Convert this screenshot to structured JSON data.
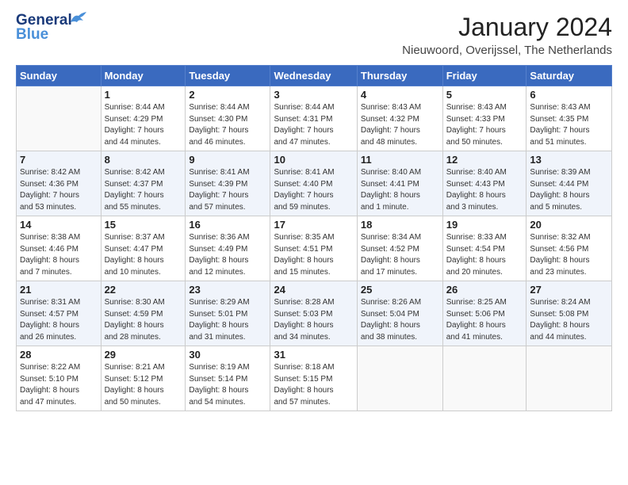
{
  "header": {
    "logo_line1": "General",
    "logo_line2": "Blue",
    "month": "January 2024",
    "location": "Nieuwoord, Overijssel, The Netherlands"
  },
  "weekdays": [
    "Sunday",
    "Monday",
    "Tuesday",
    "Wednesday",
    "Thursday",
    "Friday",
    "Saturday"
  ],
  "weeks": [
    [
      {
        "num": "",
        "info": ""
      },
      {
        "num": "1",
        "info": "Sunrise: 8:44 AM\nSunset: 4:29 PM\nDaylight: 7 hours\nand 44 minutes."
      },
      {
        "num": "2",
        "info": "Sunrise: 8:44 AM\nSunset: 4:30 PM\nDaylight: 7 hours\nand 46 minutes."
      },
      {
        "num": "3",
        "info": "Sunrise: 8:44 AM\nSunset: 4:31 PM\nDaylight: 7 hours\nand 47 minutes."
      },
      {
        "num": "4",
        "info": "Sunrise: 8:43 AM\nSunset: 4:32 PM\nDaylight: 7 hours\nand 48 minutes."
      },
      {
        "num": "5",
        "info": "Sunrise: 8:43 AM\nSunset: 4:33 PM\nDaylight: 7 hours\nand 50 minutes."
      },
      {
        "num": "6",
        "info": "Sunrise: 8:43 AM\nSunset: 4:35 PM\nDaylight: 7 hours\nand 51 minutes."
      }
    ],
    [
      {
        "num": "7",
        "info": "Sunrise: 8:42 AM\nSunset: 4:36 PM\nDaylight: 7 hours\nand 53 minutes."
      },
      {
        "num": "8",
        "info": "Sunrise: 8:42 AM\nSunset: 4:37 PM\nDaylight: 7 hours\nand 55 minutes."
      },
      {
        "num": "9",
        "info": "Sunrise: 8:41 AM\nSunset: 4:39 PM\nDaylight: 7 hours\nand 57 minutes."
      },
      {
        "num": "10",
        "info": "Sunrise: 8:41 AM\nSunset: 4:40 PM\nDaylight: 7 hours\nand 59 minutes."
      },
      {
        "num": "11",
        "info": "Sunrise: 8:40 AM\nSunset: 4:41 PM\nDaylight: 8 hours\nand 1 minute."
      },
      {
        "num": "12",
        "info": "Sunrise: 8:40 AM\nSunset: 4:43 PM\nDaylight: 8 hours\nand 3 minutes."
      },
      {
        "num": "13",
        "info": "Sunrise: 8:39 AM\nSunset: 4:44 PM\nDaylight: 8 hours\nand 5 minutes."
      }
    ],
    [
      {
        "num": "14",
        "info": "Sunrise: 8:38 AM\nSunset: 4:46 PM\nDaylight: 8 hours\nand 7 minutes."
      },
      {
        "num": "15",
        "info": "Sunrise: 8:37 AM\nSunset: 4:47 PM\nDaylight: 8 hours\nand 10 minutes."
      },
      {
        "num": "16",
        "info": "Sunrise: 8:36 AM\nSunset: 4:49 PM\nDaylight: 8 hours\nand 12 minutes."
      },
      {
        "num": "17",
        "info": "Sunrise: 8:35 AM\nSunset: 4:51 PM\nDaylight: 8 hours\nand 15 minutes."
      },
      {
        "num": "18",
        "info": "Sunrise: 8:34 AM\nSunset: 4:52 PM\nDaylight: 8 hours\nand 17 minutes."
      },
      {
        "num": "19",
        "info": "Sunrise: 8:33 AM\nSunset: 4:54 PM\nDaylight: 8 hours\nand 20 minutes."
      },
      {
        "num": "20",
        "info": "Sunrise: 8:32 AM\nSunset: 4:56 PM\nDaylight: 8 hours\nand 23 minutes."
      }
    ],
    [
      {
        "num": "21",
        "info": "Sunrise: 8:31 AM\nSunset: 4:57 PM\nDaylight: 8 hours\nand 26 minutes."
      },
      {
        "num": "22",
        "info": "Sunrise: 8:30 AM\nSunset: 4:59 PM\nDaylight: 8 hours\nand 28 minutes."
      },
      {
        "num": "23",
        "info": "Sunrise: 8:29 AM\nSunset: 5:01 PM\nDaylight: 8 hours\nand 31 minutes."
      },
      {
        "num": "24",
        "info": "Sunrise: 8:28 AM\nSunset: 5:03 PM\nDaylight: 8 hours\nand 34 minutes."
      },
      {
        "num": "25",
        "info": "Sunrise: 8:26 AM\nSunset: 5:04 PM\nDaylight: 8 hours\nand 38 minutes."
      },
      {
        "num": "26",
        "info": "Sunrise: 8:25 AM\nSunset: 5:06 PM\nDaylight: 8 hours\nand 41 minutes."
      },
      {
        "num": "27",
        "info": "Sunrise: 8:24 AM\nSunset: 5:08 PM\nDaylight: 8 hours\nand 44 minutes."
      }
    ],
    [
      {
        "num": "28",
        "info": "Sunrise: 8:22 AM\nSunset: 5:10 PM\nDaylight: 8 hours\nand 47 minutes."
      },
      {
        "num": "29",
        "info": "Sunrise: 8:21 AM\nSunset: 5:12 PM\nDaylight: 8 hours\nand 50 minutes."
      },
      {
        "num": "30",
        "info": "Sunrise: 8:19 AM\nSunset: 5:14 PM\nDaylight: 8 hours\nand 54 minutes."
      },
      {
        "num": "31",
        "info": "Sunrise: 8:18 AM\nSunset: 5:15 PM\nDaylight: 8 hours\nand 57 minutes."
      },
      {
        "num": "",
        "info": ""
      },
      {
        "num": "",
        "info": ""
      },
      {
        "num": "",
        "info": ""
      }
    ]
  ]
}
